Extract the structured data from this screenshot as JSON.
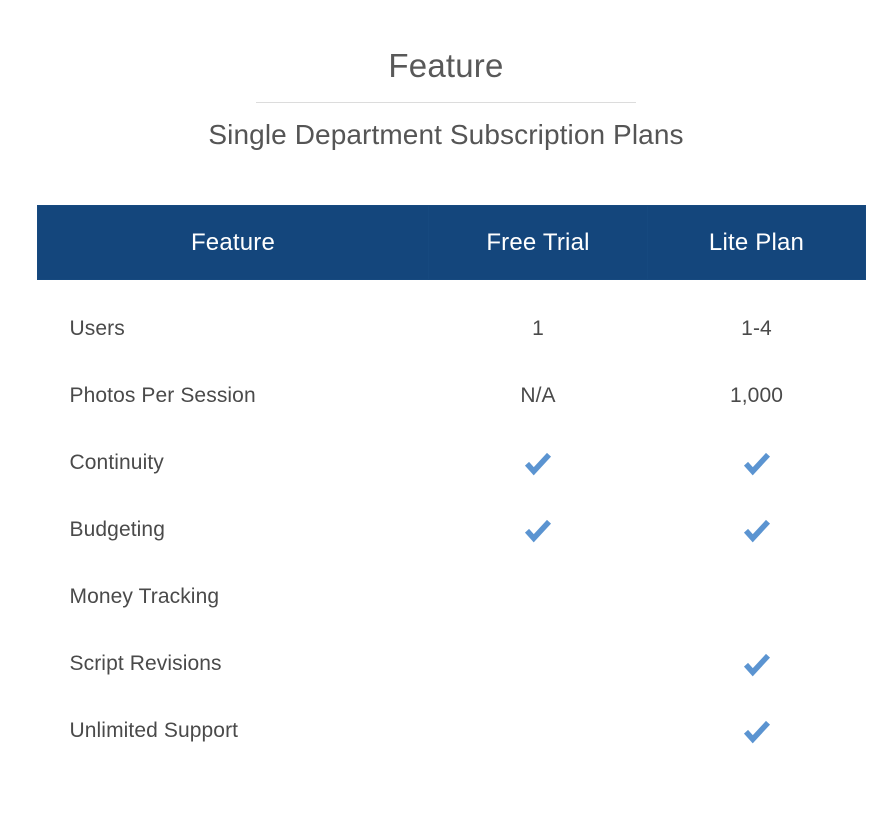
{
  "header": {
    "title": "Feature",
    "subtitle": "Single Department Subscription Plans"
  },
  "colors": {
    "table_header_bg": "#14467c",
    "table_header_text": "#ffffff",
    "check_blue": "#5b94d1",
    "body_text": "#4a4a4a",
    "title_text": "#595959",
    "rule": "#dcdcdc",
    "page_bg": "#ffffff"
  },
  "table": {
    "columns": [
      {
        "label": "Feature",
        "key": "feature",
        "align": "center"
      },
      {
        "label": "Free Trial",
        "key": "free_trial",
        "align": "center"
      },
      {
        "label": "Lite Plan",
        "key": "lite_plan",
        "align": "center"
      }
    ],
    "rows": [
      {
        "feature": "Users",
        "free_trial": "1",
        "lite_plan": "1-4",
        "free_trial_check": false,
        "lite_plan_check": false
      },
      {
        "feature": "Photos Per Session",
        "free_trial": "N/A",
        "lite_plan": "1,000",
        "free_trial_check": false,
        "lite_plan_check": false
      },
      {
        "feature": "Continuity",
        "free_trial": "",
        "lite_plan": "",
        "free_trial_check": true,
        "lite_plan_check": true
      },
      {
        "feature": "Budgeting",
        "free_trial": "",
        "lite_plan": "",
        "free_trial_check": true,
        "lite_plan_check": true
      },
      {
        "feature": "Money Tracking",
        "free_trial": "",
        "lite_plan": "",
        "free_trial_check": false,
        "lite_plan_check": false
      },
      {
        "feature": "Script Revisions",
        "free_trial": "",
        "lite_plan": "",
        "free_trial_check": false,
        "lite_plan_check": true
      },
      {
        "feature": "Unlimited Support",
        "free_trial": "",
        "lite_plan": "",
        "free_trial_check": false,
        "lite_plan_check": true
      }
    ]
  },
  "icons": {
    "check": "check-icon"
  }
}
